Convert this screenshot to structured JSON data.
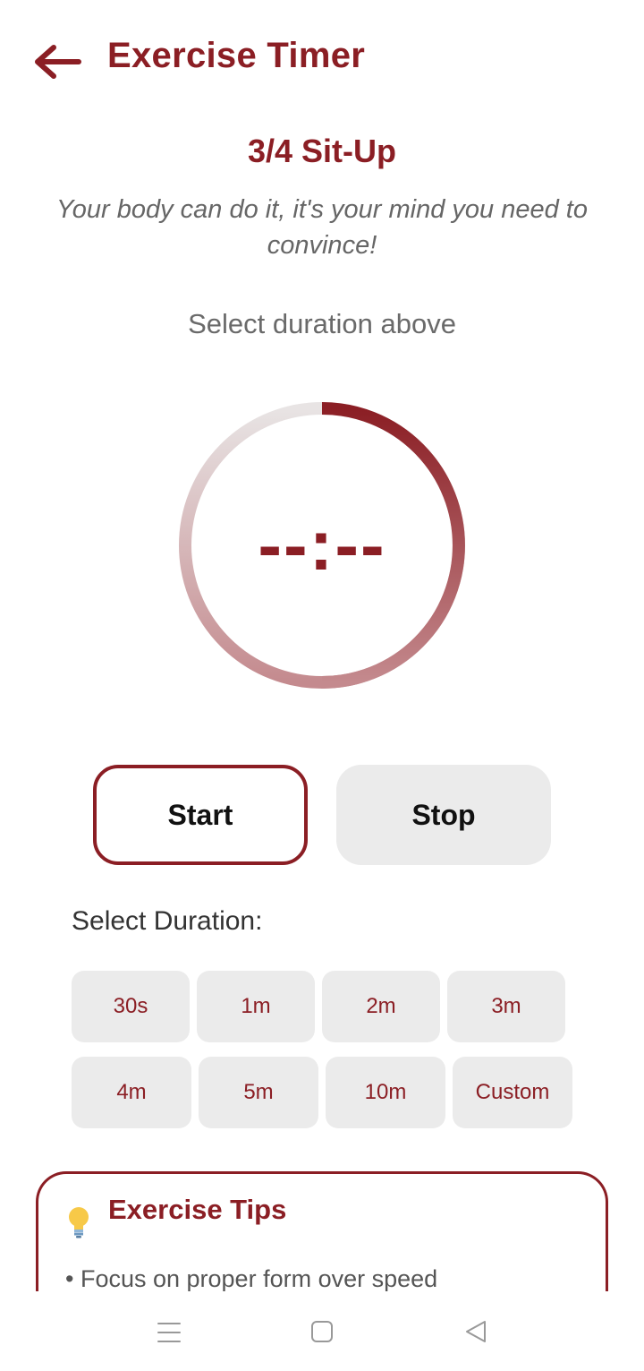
{
  "header": {
    "title": "Exercise Timer",
    "back_icon": "arrow-left-icon"
  },
  "exercise": {
    "name": "3/4 Sit-Up",
    "quote": "Your body can do it, it's your mind you need to convince!",
    "hint": "Select duration above"
  },
  "timer": {
    "display": "--:--",
    "progress_fraction": 0.0
  },
  "controls": {
    "start_label": "Start",
    "stop_label": "Stop"
  },
  "durations": {
    "label": "Select Duration:",
    "row1": [
      "30s",
      "1m",
      "2m",
      "3m"
    ],
    "row2": [
      "4m",
      "5m",
      "10m",
      "Custom"
    ]
  },
  "tips": {
    "title": "Exercise Tips",
    "items": [
      "• Focus on proper form over speed"
    ]
  },
  "colors": {
    "accent": "#8b1e24",
    "chip_bg": "#ebebeb",
    "text_muted": "#666666"
  },
  "system_nav": {
    "icons": [
      "menu-icon",
      "home-square-icon",
      "back-triangle-icon"
    ]
  }
}
